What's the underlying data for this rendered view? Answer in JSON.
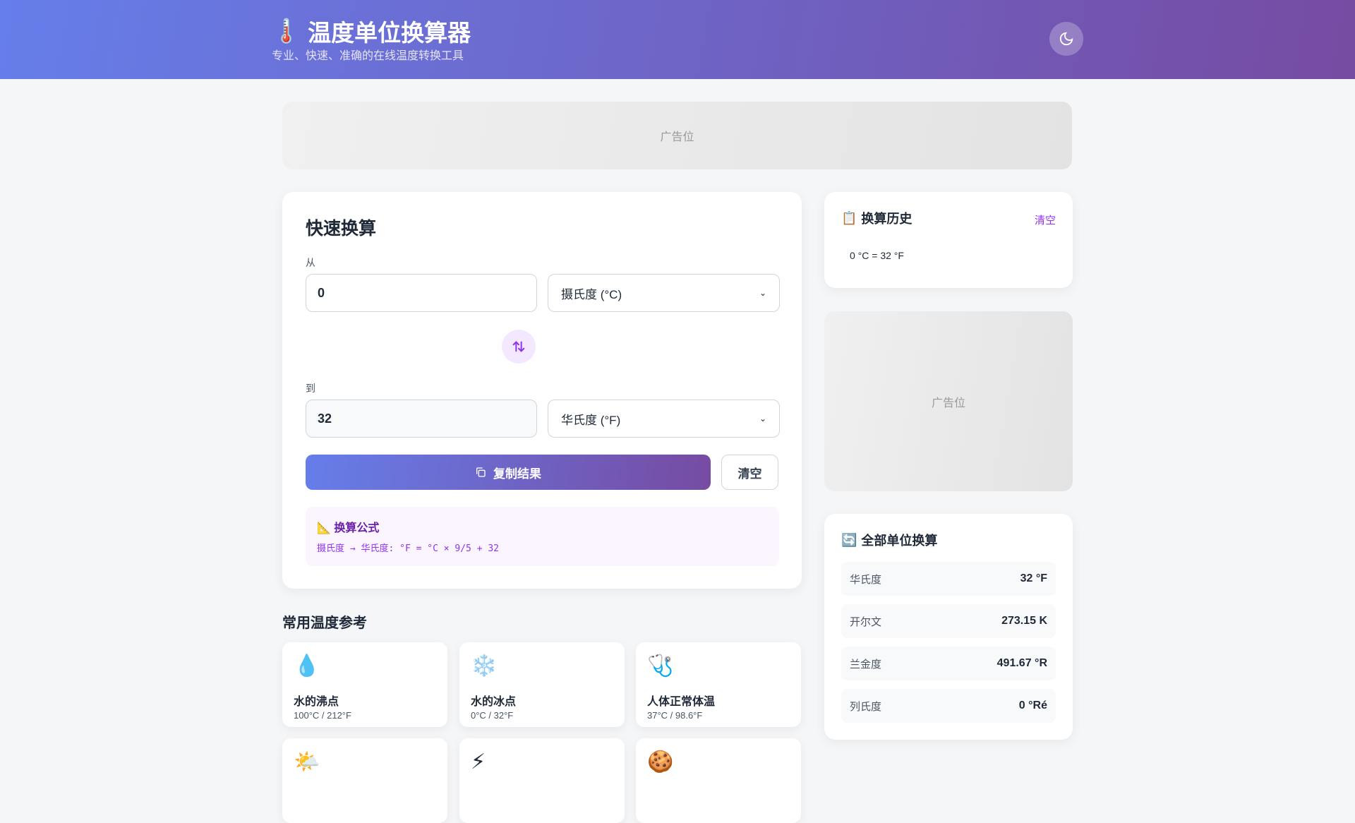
{
  "header": {
    "icon": "thermometer-icon",
    "title": "温度单位换算器",
    "subtitle": "专业、快速、准确的在线温度转换工具",
    "theme_toggle": "moon-icon"
  },
  "ads": {
    "top": "广告位",
    "side": "广告位"
  },
  "converter": {
    "title": "快速换算",
    "from_label": "从",
    "from_value": "0",
    "from_unit": "摄氏度 (°C)",
    "to_label": "到",
    "to_value": "32",
    "to_unit": "华氏度 (°F)",
    "copy_label": "复制结果",
    "clear_label": "清空",
    "formula_title": "换算公式",
    "formula_text": "摄氏度 → 华氏度: °F = °C × 9/5 + 32"
  },
  "history": {
    "title": "换算历史",
    "clear": "清空",
    "items": [
      "0 °C = 32 °F"
    ]
  },
  "all_units": {
    "title": "全部单位换算",
    "rows": [
      {
        "unit": "华氏度",
        "value": "32 °F"
      },
      {
        "unit": "开尔文",
        "value": "273.15 K"
      },
      {
        "unit": "兰金度",
        "value": "491.67 °R"
      },
      {
        "unit": "列氏度",
        "value": "0 °Ré"
      }
    ]
  },
  "reference": {
    "title": "常用温度参考",
    "items": [
      {
        "icon": "💧",
        "name": "水的沸点",
        "value": "100°C / 212°F"
      },
      {
        "icon": "❄️",
        "name": "水的冰点",
        "value": "0°C / 32°F"
      },
      {
        "icon": "🩺",
        "name": "人体正常体温",
        "value": "37°C / 98.6°F"
      },
      {
        "icon": "🌤️"
      },
      {
        "icon": "⚡"
      },
      {
        "icon": "🍪"
      }
    ]
  }
}
